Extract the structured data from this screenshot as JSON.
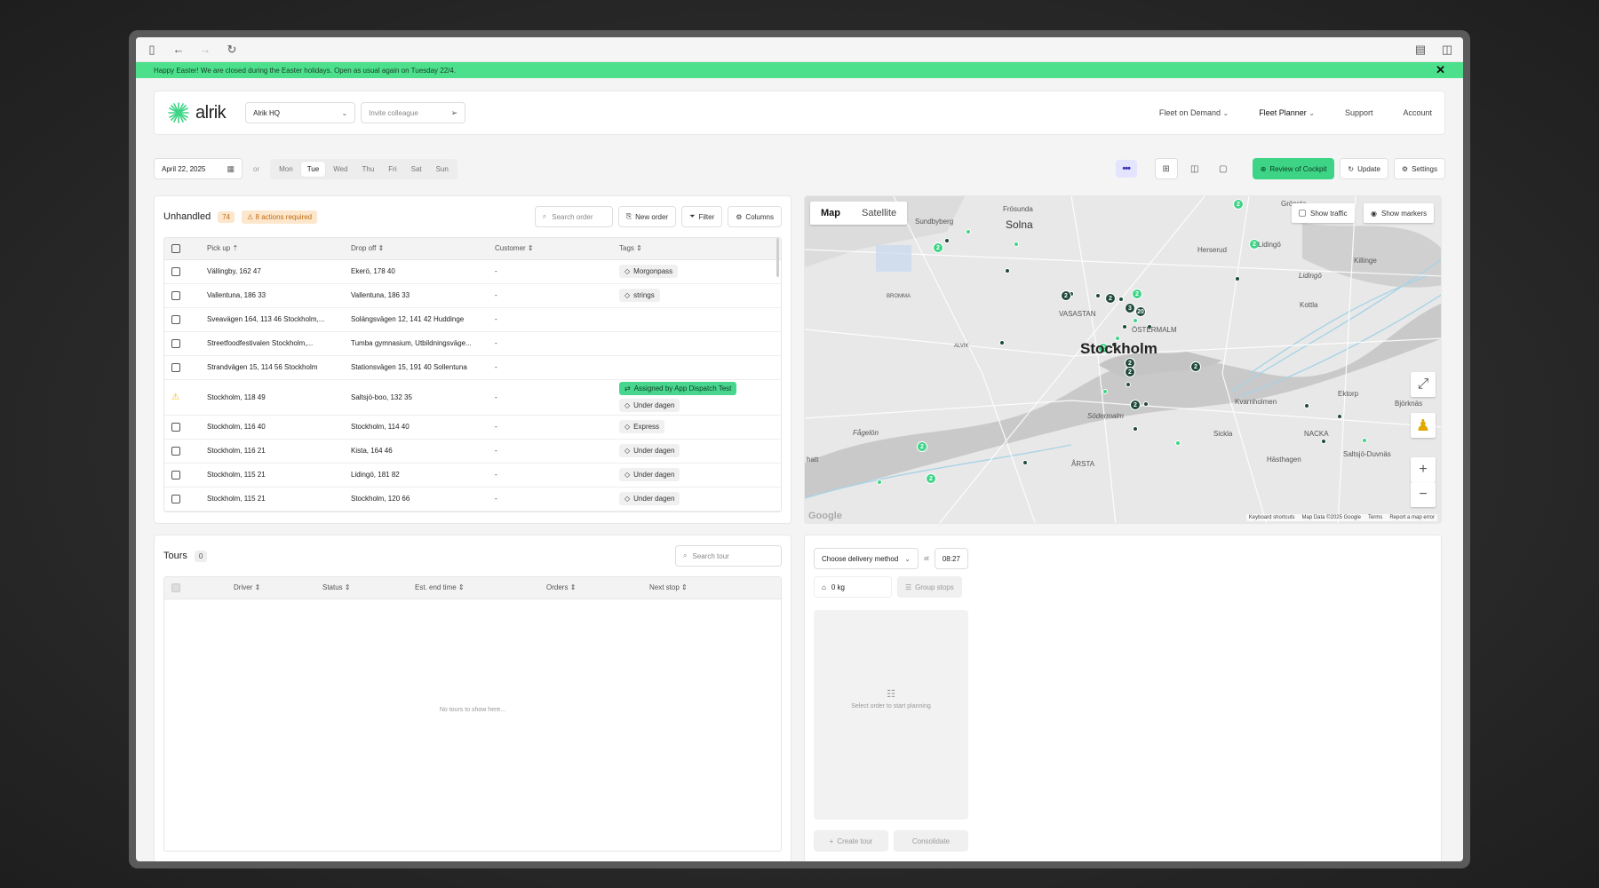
{
  "banner": {
    "text": "Happy Easter! We are closed during the Easter holidays. Open as usual again on Tuesday 22/4."
  },
  "nav": {
    "logo": "alrik",
    "location": "Alrik HQ",
    "invite_placeholder": "Invite colleague",
    "links": [
      "Fleet on Demand",
      "Fleet Planner",
      "Support",
      "Account"
    ]
  },
  "toolbar": {
    "date": "April 22, 2025",
    "or": "or",
    "days": [
      "Mon",
      "Tue",
      "Wed",
      "Thu",
      "Fri",
      "Sat",
      "Sun"
    ],
    "active_day": "Tue",
    "review": "Review of Cockpit",
    "update": "Update",
    "settings": "Settings"
  },
  "unhandled": {
    "title": "Unhandled",
    "count": "74",
    "actions": "8 actions required",
    "search_placeholder": "Search order",
    "new_order": "New order",
    "filter": "Filter",
    "columns": "Columns",
    "headers": [
      "Pick up",
      "Drop off",
      "Customer",
      "Tags"
    ],
    "rows": [
      {
        "pickup": "Vällingby, 162 47",
        "dropoff": "Ekerö, 178 40",
        "customer": "-",
        "tags": [
          "Morgonpass"
        ]
      },
      {
        "pickup": "Vallentuna, 186 33",
        "dropoff": "Vallentuna, 186 33",
        "customer": "-",
        "tags": [
          "strings"
        ]
      },
      {
        "pickup": "Sveavägen 164, 113 46 Stockholm,...",
        "dropoff": "Solängsvägen 12, 141 42 Huddinge",
        "customer": "-",
        "tags": []
      },
      {
        "pickup": "Streetfoodfestivalen Stockholm,...",
        "dropoff": "Tumba gymnasium, Utbildningsväge...",
        "customer": "-",
        "tags": []
      },
      {
        "pickup": "Strandvägen 15, 114 56 Stockholm",
        "dropoff": "Stationsvägen 15, 191 40 Sollentuna",
        "customer": "-",
        "tags": []
      },
      {
        "pickup": "Stockholm, 118 49",
        "dropoff": "Saltsjö-boo, 132 35",
        "customer": "-",
        "tags": [
          "Assigned by App Dispatch Test",
          "Under dagen"
        ],
        "warning": true
      },
      {
        "pickup": "Stockholm, 116 40",
        "dropoff": "Stockholm, 114 40",
        "customer": "-",
        "tags": [
          "Express"
        ]
      },
      {
        "pickup": "Stockholm, 116 21",
        "dropoff": "Kista, 164 46",
        "customer": "-",
        "tags": [
          "Under dagen"
        ]
      },
      {
        "pickup": "Stockholm, 115 21",
        "dropoff": "Lidingö, 181 82",
        "customer": "-",
        "tags": [
          "Under dagen"
        ]
      },
      {
        "pickup": "Stockholm, 115 21",
        "dropoff": "Stockholm, 120 66",
        "customer": "-",
        "tags": [
          "Under dagen"
        ]
      }
    ]
  },
  "map": {
    "tab_map": "Map",
    "tab_satellite": "Satellite",
    "show_traffic": "Show traffic",
    "show_markers": "Show markers",
    "labels": {
      "sundbyberg": "Sundbyberg",
      "solna": "Solna",
      "frosunda": "Frösunda",
      "gronsta": "Grönsta",
      "herserud": "Herserud",
      "lidingo": "Lidingö",
      "lidingo2": "Lidingö",
      "killinge": "Killinge",
      "vasastan": "VASASTAN",
      "ostermalm": "ÖSTERMALM",
      "stockholm": "Stockholm",
      "kottla": "Kottla",
      "kvarnholmen": "Kvarnholmen",
      "ektorp": "Ektorp",
      "bjorknas": "Björknäs",
      "sodermalm": "Södermalm",
      "sickla": "Sickla",
      "nacka": "NACKA",
      "hasthagen": "Hästhagen",
      "saltsjoduvnas": "Saltsjö-Duvnäs",
      "fagelon": "Fågelön",
      "arsta": "ÅRSTA",
      "hatt": "hatt",
      "bromma": "BROMMA",
      "alvik": "ALVIK"
    },
    "footer": [
      "Keyboard shortcuts",
      "Map Data ©2025 Google",
      "Terms",
      "Report a map error"
    ],
    "google": "Google"
  },
  "tours": {
    "title": "Tours",
    "count": "0",
    "search_placeholder": "Search tour",
    "headers": [
      "Driver",
      "Status",
      "Est. end time",
      "Orders",
      "Next stop"
    ],
    "empty": "No tours to show here..."
  },
  "plan": {
    "delivery": "Choose delivery method",
    "at": "at",
    "time": "08:27",
    "weight": "0 kg",
    "group": "Group stops",
    "empty": "Select order to start planning",
    "create": "Create tour",
    "consolidate": "Consolidate"
  },
  "colors": {
    "accent": "#3ed486",
    "banner": "#4ce08c",
    "warn": "#f0b400"
  }
}
